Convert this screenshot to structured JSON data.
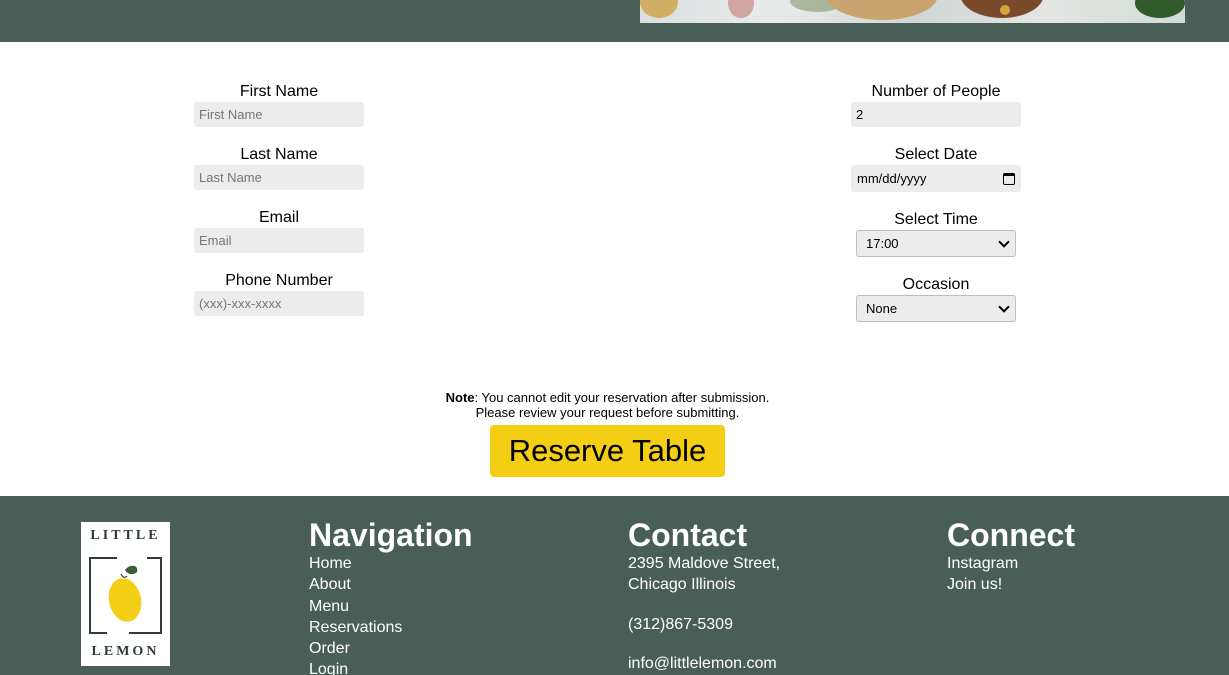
{
  "form": {
    "first_name": {
      "label": "First Name",
      "placeholder": "First Name"
    },
    "last_name": {
      "label": "Last Name",
      "placeholder": "Last Name"
    },
    "email": {
      "label": "Email",
      "placeholder": "Email"
    },
    "phone": {
      "label": "Phone Number",
      "placeholder": "(xxx)-xxx-xxxx"
    },
    "people": {
      "label": "Number of People",
      "value": "2"
    },
    "date": {
      "label": "Select Date",
      "value": "mm/dd/yyyy"
    },
    "time": {
      "label": "Select Time",
      "value": "17:00"
    },
    "occasion": {
      "label": "Occasion",
      "value": "None"
    }
  },
  "note": {
    "bold": "Note",
    "line1": ": You cannot edit your reservation after submission.",
    "line2": "Please review your request before submitting."
  },
  "reserve_label": "Reserve Table",
  "footer": {
    "logo": {
      "top": "LITTLE",
      "bottom": "LEMON"
    },
    "navigation": {
      "heading": "Navigation",
      "items": [
        "Home",
        "About",
        "Menu",
        "Reservations",
        "Order",
        "Login"
      ]
    },
    "contact": {
      "heading": "Contact",
      "address1": "2395 Maldove Street,",
      "address2": "Chicago Illinois",
      "phone": "(312)867-5309",
      "email": "info@littlelemon.com"
    },
    "connect": {
      "heading": "Connect",
      "items": [
        "Instagram",
        "Join us!"
      ]
    }
  },
  "colors": {
    "header_bg": "#495e57",
    "accent": "#f4ce14",
    "field_bg": "#ececec"
  }
}
